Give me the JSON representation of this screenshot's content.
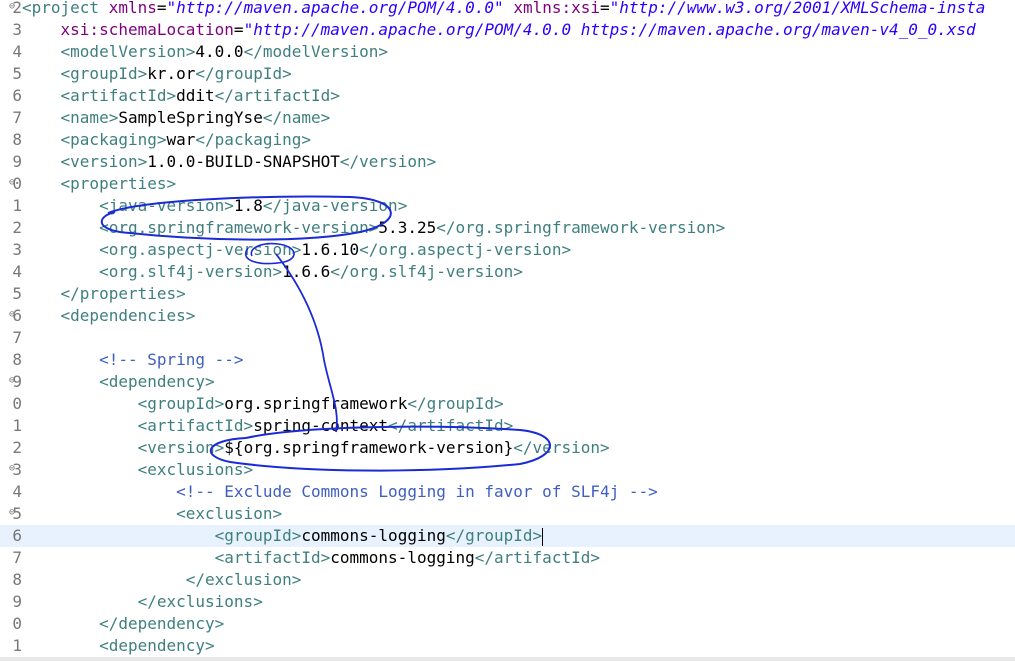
{
  "editor": {
    "lines": [
      {
        "num": "2",
        "fold": "⊖",
        "tokens": [
          [
            "tag",
            "<project "
          ],
          [
            "attr",
            "xmlns"
          ],
          [
            "txt",
            "="
          ],
          [
            "str",
            "\"http://maven.apache.org/POM/4.0.0\""
          ],
          [
            "txt",
            " "
          ],
          [
            "attr",
            "xmlns:xsi"
          ],
          [
            "txt",
            "="
          ],
          [
            "str",
            "\"http://www.w3.org/2001/XMLSchema-insta"
          ]
        ]
      },
      {
        "num": "3",
        "tokens": [
          [
            "txt",
            "    "
          ],
          [
            "attr",
            "xsi:schemaLocation"
          ],
          [
            "txt",
            "="
          ],
          [
            "str",
            "\"http://maven.apache.org/POM/4.0.0 https://maven.apache.org/maven-v4_0_0.xsd"
          ]
        ]
      },
      {
        "num": "4",
        "tokens": [
          [
            "txt",
            "    "
          ],
          [
            "tag",
            "<modelVersion>"
          ],
          [
            "txt",
            "4.0.0"
          ],
          [
            "tag",
            "</modelVersion>"
          ]
        ]
      },
      {
        "num": "5",
        "tokens": [
          [
            "txt",
            "    "
          ],
          [
            "tag",
            "<groupId>"
          ],
          [
            "txt",
            "kr.or"
          ],
          [
            "tag",
            "</groupId>"
          ]
        ]
      },
      {
        "num": "6",
        "tokens": [
          [
            "txt",
            "    "
          ],
          [
            "tag",
            "<artifactId>"
          ],
          [
            "txt",
            "ddit"
          ],
          [
            "tag",
            "</artifactId>"
          ]
        ]
      },
      {
        "num": "7",
        "tokens": [
          [
            "txt",
            "    "
          ],
          [
            "tag",
            "<name>"
          ],
          [
            "txt",
            "SampleSpringYse"
          ],
          [
            "tag",
            "</name>"
          ]
        ]
      },
      {
        "num": "8",
        "tokens": [
          [
            "txt",
            "    "
          ],
          [
            "tag",
            "<packaging>"
          ],
          [
            "txt",
            "war"
          ],
          [
            "tag",
            "</packaging>"
          ]
        ]
      },
      {
        "num": "9",
        "tokens": [
          [
            "txt",
            "    "
          ],
          [
            "tag",
            "<version>"
          ],
          [
            "txt",
            "1.0.0-BUILD-SNAPSHOT"
          ],
          [
            "tag",
            "</version>"
          ]
        ]
      },
      {
        "num": "0",
        "fold": "⊖",
        "tokens": [
          [
            "txt",
            "    "
          ],
          [
            "tag",
            "<properties>"
          ]
        ]
      },
      {
        "num": "1",
        "tokens": [
          [
            "txt",
            "        "
          ],
          [
            "tag",
            "<java-version>"
          ],
          [
            "txt",
            "1.8"
          ],
          [
            "tag",
            "</java-version>"
          ]
        ]
      },
      {
        "num": "2",
        "tokens": [
          [
            "txt",
            "        "
          ],
          [
            "tag",
            "<org.springframework-version>"
          ],
          [
            "txt",
            "5.3.25"
          ],
          [
            "tag",
            "</org.springframework-version>"
          ]
        ]
      },
      {
        "num": "3",
        "tokens": [
          [
            "txt",
            "        "
          ],
          [
            "tag",
            "<org.aspectj-version>"
          ],
          [
            "txt",
            "1.6.10"
          ],
          [
            "tag",
            "</org.aspectj-version>"
          ]
        ]
      },
      {
        "num": "4",
        "tokens": [
          [
            "txt",
            "        "
          ],
          [
            "tag",
            "<org.slf4j-version>"
          ],
          [
            "txt",
            "1.6.6"
          ],
          [
            "tag",
            "</org.slf4j-version>"
          ]
        ]
      },
      {
        "num": "5",
        "tokens": [
          [
            "txt",
            "    "
          ],
          [
            "tag",
            "</properties>"
          ]
        ]
      },
      {
        "num": "6",
        "fold": "⊖",
        "tokens": [
          [
            "txt",
            "    "
          ],
          [
            "tag",
            "<dependencies>"
          ]
        ]
      },
      {
        "num": "7",
        "tokens": []
      },
      {
        "num": "8",
        "tokens": [
          [
            "txt",
            "        "
          ],
          [
            "cmt",
            "<!-- Spring -->"
          ]
        ]
      },
      {
        "num": "9",
        "fold": "⊖",
        "tokens": [
          [
            "txt",
            "        "
          ],
          [
            "tag",
            "<dependency>"
          ]
        ]
      },
      {
        "num": "0",
        "tokens": [
          [
            "txt",
            "            "
          ],
          [
            "tag",
            "<groupId>"
          ],
          [
            "txt",
            "org.springframework"
          ],
          [
            "tag",
            "</groupId>"
          ]
        ]
      },
      {
        "num": "1",
        "tokens": [
          [
            "txt",
            "            "
          ],
          [
            "tag",
            "<artifactId>"
          ],
          [
            "txt",
            "spring-context"
          ],
          [
            "tag",
            "</artifactId>"
          ]
        ]
      },
      {
        "num": "2",
        "tokens": [
          [
            "txt",
            "            "
          ],
          [
            "tag",
            "<version>"
          ],
          [
            "txt",
            "${org.springframework-version}"
          ],
          [
            "tag",
            "</version>"
          ]
        ]
      },
      {
        "num": "3",
        "fold": "⊖",
        "tokens": [
          [
            "txt",
            "            "
          ],
          [
            "tag",
            "<exclusions>"
          ]
        ]
      },
      {
        "num": "4",
        "tokens": [
          [
            "txt",
            "                "
          ],
          [
            "cmt",
            "<!-- Exclude Commons Logging in favor of SLF4j -->"
          ]
        ]
      },
      {
        "num": "5",
        "fold": "⊖",
        "tokens": [
          [
            "txt",
            "                "
          ],
          [
            "tag",
            "<exclusion>"
          ]
        ]
      },
      {
        "num": "6",
        "current": true,
        "tokens": [
          [
            "txt",
            "                    "
          ],
          [
            "tag",
            "<groupId>"
          ],
          [
            "txt",
            "commons-logging"
          ],
          [
            "tag",
            "</groupId>"
          ]
        ]
      },
      {
        "num": "7",
        "tokens": [
          [
            "txt",
            "                    "
          ],
          [
            "tag",
            "<artifactId>"
          ],
          [
            "txt",
            "commons-logging"
          ],
          [
            "tag",
            "</artifactId>"
          ]
        ]
      },
      {
        "num": "8",
        "tokens": [
          [
            "txt",
            "                 "
          ],
          [
            "tag",
            "</exclusion>"
          ]
        ]
      },
      {
        "num": "9",
        "tokens": [
          [
            "txt",
            "            "
          ],
          [
            "tag",
            "</exclusions>"
          ]
        ]
      },
      {
        "num": "0",
        "tokens": [
          [
            "txt",
            "        "
          ],
          [
            "tag",
            "</dependency>"
          ]
        ]
      },
      {
        "num": "1",
        "tokens": [
          [
            "txt",
            "        "
          ],
          [
            "tag",
            "<dependency>"
          ]
        ]
      }
    ]
  },
  "colors": {
    "tag": "#3f7f7f",
    "attr": "#7f007f",
    "string": "#2a00ff",
    "comment": "#3f5fbf",
    "current_line": "#e8f2fe",
    "annotation_ink": "#1a2bd6"
  },
  "icons": {
    "fold": "collapse-minus-icon"
  }
}
